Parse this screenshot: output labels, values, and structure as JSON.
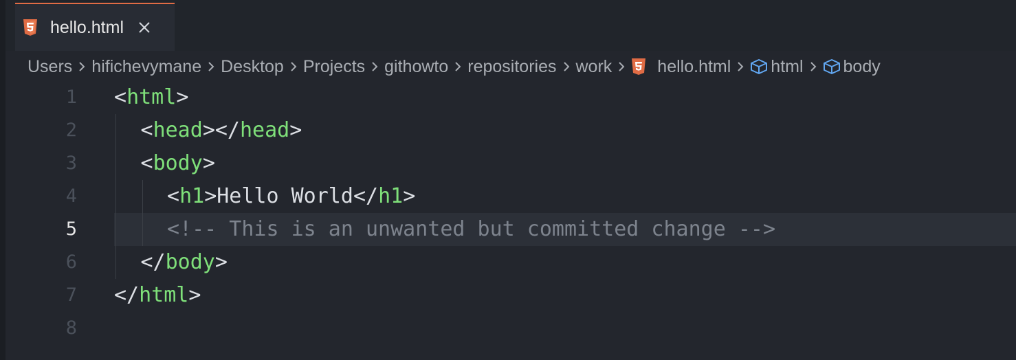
{
  "tab": {
    "label": "hello.html",
    "icon": "html5-icon",
    "accent_color": "#e06c45"
  },
  "breadcrumb": [
    {
      "label": "Users",
      "icon": null
    },
    {
      "label": "hifichevymane",
      "icon": null
    },
    {
      "label": "Desktop",
      "icon": null
    },
    {
      "label": "Projects",
      "icon": null
    },
    {
      "label": "githowto",
      "icon": null
    },
    {
      "label": "repositories",
      "icon": null
    },
    {
      "label": "work",
      "icon": null
    },
    {
      "label": "hello.html",
      "icon": "html5-icon"
    },
    {
      "label": "html",
      "icon": "cube-icon"
    },
    {
      "label": "body",
      "icon": "cube-icon"
    }
  ],
  "editor": {
    "active_line": 5,
    "lines": [
      {
        "number": "1",
        "indent": 0,
        "tokens": [
          [
            "punc",
            "<"
          ],
          [
            "tag",
            "html"
          ],
          [
            "punc",
            ">"
          ]
        ]
      },
      {
        "number": "2",
        "indent": 1,
        "tokens": [
          [
            "punc",
            "<"
          ],
          [
            "tag",
            "head"
          ],
          [
            "punc",
            "></"
          ],
          [
            "tag",
            "head"
          ],
          [
            "punc",
            ">"
          ]
        ]
      },
      {
        "number": "3",
        "indent": 1,
        "tokens": [
          [
            "punc",
            "<"
          ],
          [
            "tag",
            "body"
          ],
          [
            "punc",
            ">"
          ]
        ]
      },
      {
        "number": "4",
        "indent": 2,
        "tokens": [
          [
            "punc",
            "<"
          ],
          [
            "tag",
            "h1"
          ],
          [
            "punc",
            ">"
          ],
          [
            "txt",
            "Hello World"
          ],
          [
            "punc",
            "</"
          ],
          [
            "tag",
            "h1"
          ],
          [
            "punc",
            ">"
          ]
        ]
      },
      {
        "number": "5",
        "indent": 2,
        "tokens": [
          [
            "comment",
            "<!-- This is an unwanted but committed change -->"
          ]
        ]
      },
      {
        "number": "6",
        "indent": 1,
        "tokens": [
          [
            "punc",
            "</"
          ],
          [
            "tag",
            "body"
          ],
          [
            "punc",
            ">"
          ]
        ]
      },
      {
        "number": "7",
        "indent": 0,
        "tokens": [
          [
            "punc",
            "</"
          ],
          [
            "tag",
            "html"
          ],
          [
            "punc",
            ">"
          ]
        ]
      },
      {
        "number": "8",
        "indent": 0,
        "tokens": []
      }
    ]
  }
}
